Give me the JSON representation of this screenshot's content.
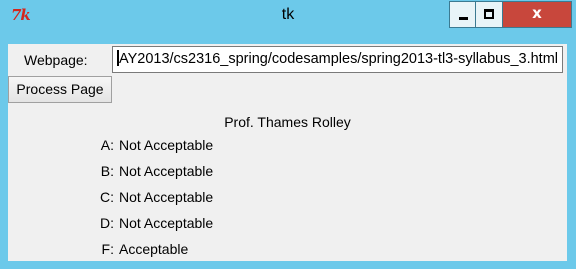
{
  "window": {
    "title": "tk",
    "icon_text": "7k",
    "icon_name": "tk-feather-icon",
    "controls": {
      "minimize_icon": "minimize-icon",
      "maximize_icon": "maximize-icon",
      "close_icon": "close-icon",
      "close_glyph": "x"
    },
    "colors": {
      "frame": "#6cc9ea",
      "close_button": "#c8473c",
      "client": "#f0f0f0"
    }
  },
  "form": {
    "webpage_label": "Webpage:",
    "url_value": "AY2013/cs2316_spring/codesamples/spring2013-tl3-syllabus_3.html",
    "process_button_label": "Process Page"
  },
  "results": {
    "professor": "Prof. Thames Rolley",
    "grades": [
      {
        "letter": "A:",
        "result": "Not Acceptable"
      },
      {
        "letter": "B:",
        "result": "Not Acceptable"
      },
      {
        "letter": "C:",
        "result": "Not Acceptable"
      },
      {
        "letter": "D:",
        "result": "Not Acceptable"
      },
      {
        "letter": "F:",
        "result": "Acceptable"
      }
    ]
  }
}
